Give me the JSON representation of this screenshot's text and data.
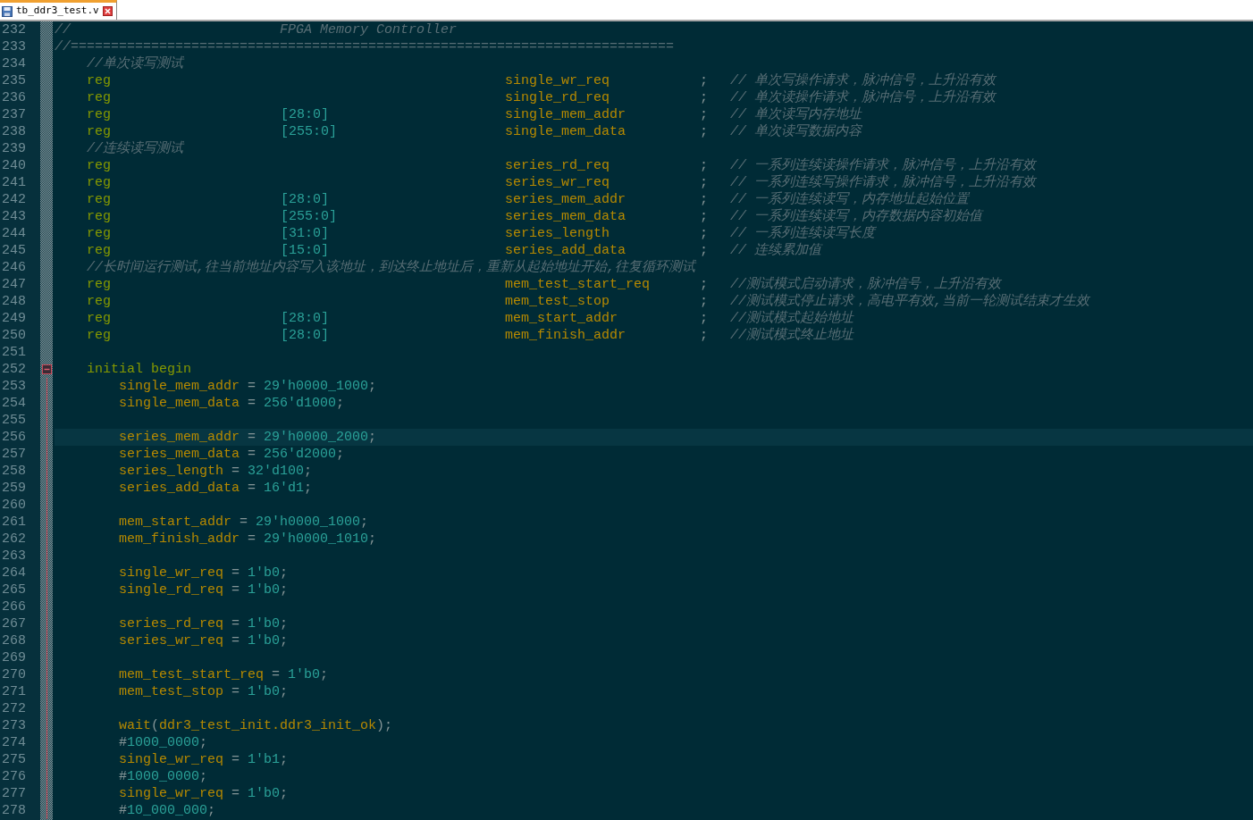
{
  "tabs": [
    {
      "label": "tb_ddr3_test.v",
      "selected": true
    }
  ],
  "lines": [
    {
      "number": "232",
      "kind": "banner",
      "current": false,
      "text": "//                          FPGA Memory Controller"
    },
    {
      "number": "233",
      "kind": "banner",
      "current": false,
      "text": "//==========================================================================="
    },
    {
      "number": "234",
      "kind": "comment",
      "current": false,
      "text": "//单次读写测试"
    },
    {
      "number": "235",
      "kind": "decl",
      "current": false,
      "type": "reg",
      "name": "single_wr_req",
      "semicolon": ";",
      "comment": "// 单次写操作请求，脉冲信号，上升沿有效"
    },
    {
      "number": "236",
      "kind": "decl",
      "current": false,
      "type": "reg",
      "name": "single_rd_req",
      "semicolon": ";",
      "comment": "// 单次读操作请求，脉冲信号，上升沿有效"
    },
    {
      "number": "237",
      "kind": "decl",
      "current": false,
      "type": "reg",
      "range": "[28:0]",
      "name": "single_mem_addr",
      "semicolon": ";",
      "comment": "// 单次读写内存地址"
    },
    {
      "number": "238",
      "kind": "decl",
      "current": false,
      "type": "reg",
      "range": "[255:0]",
      "name": "single_mem_data",
      "semicolon": ";",
      "comment": "// 单次读写数据内容"
    },
    {
      "number": "239",
      "kind": "comment",
      "current": false,
      "text": "//连续读写测试"
    },
    {
      "number": "240",
      "kind": "decl",
      "current": false,
      "type": "reg",
      "name": "series_rd_req",
      "semicolon": ";",
      "comment": "// 一系列连续读操作请求，脉冲信号，上升沿有效"
    },
    {
      "number": "241",
      "kind": "decl",
      "current": false,
      "type": "reg",
      "name": "series_wr_req",
      "semicolon": ";",
      "comment": "// 一系列连续写操作请求，脉冲信号，上升沿有效"
    },
    {
      "number": "242",
      "kind": "decl",
      "current": false,
      "type": "reg",
      "range": "[28:0]",
      "name": "series_mem_addr",
      "semicolon": ";",
      "comment": "// 一系列连续读写，内存地址起始位置"
    },
    {
      "number": "243",
      "kind": "decl",
      "current": false,
      "type": "reg",
      "range": "[255:0]",
      "name": "series_mem_data",
      "semicolon": ";",
      "comment": "// 一系列连续读写，内存数据内容初始值"
    },
    {
      "number": "244",
      "kind": "decl",
      "current": false,
      "type": "reg",
      "range": "[31:0]",
      "name": "series_length",
      "semicolon": ";",
      "comment": "// 一系列连续读写长度"
    },
    {
      "number": "245",
      "kind": "decl",
      "current": false,
      "type": "reg",
      "range": "[15:0]",
      "name": "series_add_data",
      "semicolon": ";",
      "comment": "// 连续累加值"
    },
    {
      "number": "246",
      "kind": "comment",
      "current": false,
      "text": "//长时间运行测试,往当前地址内容写入该地址，到达终止地址后，重新从起始地址开始,往复循环测试"
    },
    {
      "number": "247",
      "kind": "decl",
      "current": false,
      "type": "reg",
      "name": "mem_test_start_req",
      "semicolon": ";",
      "comment": "//测试模式启动请求，脉冲信号，上升沿有效"
    },
    {
      "number": "248",
      "kind": "decl",
      "current": false,
      "type": "reg",
      "name": "mem_test_stop",
      "semicolon": ";",
      "comment": "//测试模式停止请求，高电平有效,当前一轮测试结束才生效"
    },
    {
      "number": "249",
      "kind": "decl",
      "current": false,
      "type": "reg",
      "range": "[28:0]",
      "name": "mem_start_addr",
      "semicolon": ";",
      "comment": "//测试模式起始地址"
    },
    {
      "number": "250",
      "kind": "decl",
      "current": false,
      "type": "reg",
      "range": "[28:0]",
      "name": "mem_finish_addr",
      "semicolon": ";",
      "comment": "//测试模式终止地址"
    },
    {
      "number": "251",
      "kind": "blank",
      "current": false
    },
    {
      "number": "252",
      "kind": "block",
      "current": false,
      "expanded": true,
      "tokens": [
        {
          "kind": "keyword",
          "text": "initial begin"
        }
      ],
      "children": [
        {
          "number": "253",
          "kind": "code",
          "current": false,
          "tokens": [
            {
              "kind": "ident",
              "text": "single_mem_addr"
            },
            {
              "kind": "op",
              "text": " = "
            },
            {
              "kind": "number",
              "text": "29'h0000_1000"
            },
            {
              "kind": "op",
              "text": ";"
            }
          ]
        },
        {
          "number": "254",
          "kind": "code",
          "current": false,
          "tokens": [
            {
              "kind": "ident",
              "text": "single_mem_data"
            },
            {
              "kind": "op",
              "text": " = "
            },
            {
              "kind": "number",
              "text": "256'd1000"
            },
            {
              "kind": "op",
              "text": ";"
            }
          ]
        },
        {
          "number": "255",
          "kind": "blank",
          "current": false
        },
        {
          "number": "256",
          "kind": "code",
          "current": true,
          "tokens": [
            {
              "kind": "ident",
              "text": "series_mem_addr"
            },
            {
              "kind": "op",
              "text": " = "
            },
            {
              "kind": "number",
              "text": "29'h0000_2000"
            },
            {
              "kind": "op",
              "text": ";"
            }
          ]
        },
        {
          "number": "257",
          "kind": "code",
          "current": false,
          "tokens": [
            {
              "kind": "ident",
              "text": "series_mem_data"
            },
            {
              "kind": "op",
              "text": " = "
            },
            {
              "kind": "number",
              "text": "256'd2000"
            },
            {
              "kind": "op",
              "text": ";"
            }
          ]
        },
        {
          "number": "258",
          "kind": "code",
          "current": false,
          "tokens": [
            {
              "kind": "ident",
              "text": "series_length"
            },
            {
              "kind": "op",
              "text": " = "
            },
            {
              "kind": "number",
              "text": "32'd100"
            },
            {
              "kind": "op",
              "text": ";"
            }
          ]
        },
        {
          "number": "259",
          "kind": "code",
          "current": false,
          "tokens": [
            {
              "kind": "ident",
              "text": "series_add_data"
            },
            {
              "kind": "op",
              "text": " = "
            },
            {
              "kind": "number",
              "text": "16'd1"
            },
            {
              "kind": "op",
              "text": ";"
            }
          ]
        },
        {
          "number": "260",
          "kind": "blank",
          "current": false
        },
        {
          "number": "261",
          "kind": "code",
          "current": false,
          "tokens": [
            {
              "kind": "ident",
              "text": "mem_start_addr"
            },
            {
              "kind": "op",
              "text": " = "
            },
            {
              "kind": "number",
              "text": "29'h0000_1000"
            },
            {
              "kind": "op",
              "text": ";"
            }
          ]
        },
        {
          "number": "262",
          "kind": "code",
          "current": false,
          "tokens": [
            {
              "kind": "ident",
              "text": "mem_finish_addr"
            },
            {
              "kind": "op",
              "text": " = "
            },
            {
              "kind": "number",
              "text": "29'h0000_1010"
            },
            {
              "kind": "op",
              "text": ";"
            }
          ]
        },
        {
          "number": "263",
          "kind": "blank",
          "current": false
        },
        {
          "number": "264",
          "kind": "code",
          "current": false,
          "tokens": [
            {
              "kind": "ident",
              "text": "single_wr_req"
            },
            {
              "kind": "op",
              "text": " = "
            },
            {
              "kind": "number",
              "text": "1'b0"
            },
            {
              "kind": "op",
              "text": ";"
            }
          ]
        },
        {
          "number": "265",
          "kind": "code",
          "current": false,
          "tokens": [
            {
              "kind": "ident",
              "text": "single_rd_req"
            },
            {
              "kind": "op",
              "text": " = "
            },
            {
              "kind": "number",
              "text": "1'b0"
            },
            {
              "kind": "op",
              "text": ";"
            }
          ]
        },
        {
          "number": "266",
          "kind": "blank",
          "current": false
        },
        {
          "number": "267",
          "kind": "code",
          "current": false,
          "tokens": [
            {
              "kind": "ident",
              "text": "series_rd_req"
            },
            {
              "kind": "op",
              "text": " = "
            },
            {
              "kind": "number",
              "text": "1'b0"
            },
            {
              "kind": "op",
              "text": ";"
            }
          ]
        },
        {
          "number": "268",
          "kind": "code",
          "current": false,
          "tokens": [
            {
              "kind": "ident",
              "text": "series_wr_req"
            },
            {
              "kind": "op",
              "text": " = "
            },
            {
              "kind": "number",
              "text": "1'b0"
            },
            {
              "kind": "op",
              "text": ";"
            }
          ]
        },
        {
          "number": "269",
          "kind": "blank",
          "current": false
        },
        {
          "number": "270",
          "kind": "code",
          "current": false,
          "tokens": [
            {
              "kind": "ident",
              "text": "mem_test_start_req"
            },
            {
              "kind": "op",
              "text": " = "
            },
            {
              "kind": "number",
              "text": "1'b0"
            },
            {
              "kind": "op",
              "text": ";"
            }
          ]
        },
        {
          "number": "271",
          "kind": "code",
          "current": false,
          "tokens": [
            {
              "kind": "ident",
              "text": "mem_test_stop"
            },
            {
              "kind": "op",
              "text": " = "
            },
            {
              "kind": "number",
              "text": "1'b0"
            },
            {
              "kind": "op",
              "text": ";"
            }
          ]
        },
        {
          "number": "272",
          "kind": "blank",
          "current": false
        },
        {
          "number": "273",
          "kind": "code",
          "current": false,
          "tokens": [
            {
              "kind": "ident",
              "text": "wait"
            },
            {
              "kind": "op",
              "text": "("
            },
            {
              "kind": "ident",
              "text": "ddr3_test_init.ddr3_init_ok"
            },
            {
              "kind": "op",
              "text": ");"
            }
          ]
        },
        {
          "number": "274",
          "kind": "code",
          "current": false,
          "tokens": [
            {
              "kind": "op",
              "text": "#"
            },
            {
              "kind": "number",
              "text": "1000_0000"
            },
            {
              "kind": "op",
              "text": ";"
            }
          ]
        },
        {
          "number": "275",
          "kind": "code",
          "current": false,
          "tokens": [
            {
              "kind": "ident",
              "text": "single_wr_req"
            },
            {
              "kind": "op",
              "text": " = "
            },
            {
              "kind": "number",
              "text": "1'b1"
            },
            {
              "kind": "op",
              "text": ";"
            }
          ]
        },
        {
          "number": "276",
          "kind": "code",
          "current": false,
          "tokens": [
            {
              "kind": "op",
              "text": "#"
            },
            {
              "kind": "number",
              "text": "1000_0000"
            },
            {
              "kind": "op",
              "text": ";"
            }
          ]
        },
        {
          "number": "277",
          "kind": "code",
          "current": false,
          "tokens": [
            {
              "kind": "ident",
              "text": "single_wr_req"
            },
            {
              "kind": "op",
              "text": " = "
            },
            {
              "kind": "number",
              "text": "1'b0"
            },
            {
              "kind": "op",
              "text": ";"
            }
          ]
        },
        {
          "number": "278",
          "kind": "code",
          "current": false,
          "tokens": [
            {
              "kind": "op",
              "text": "#"
            },
            {
              "kind": "number",
              "text": "10_000_000"
            },
            {
              "kind": "op",
              "text": ";"
            }
          ]
        }
      ]
    }
  ]
}
